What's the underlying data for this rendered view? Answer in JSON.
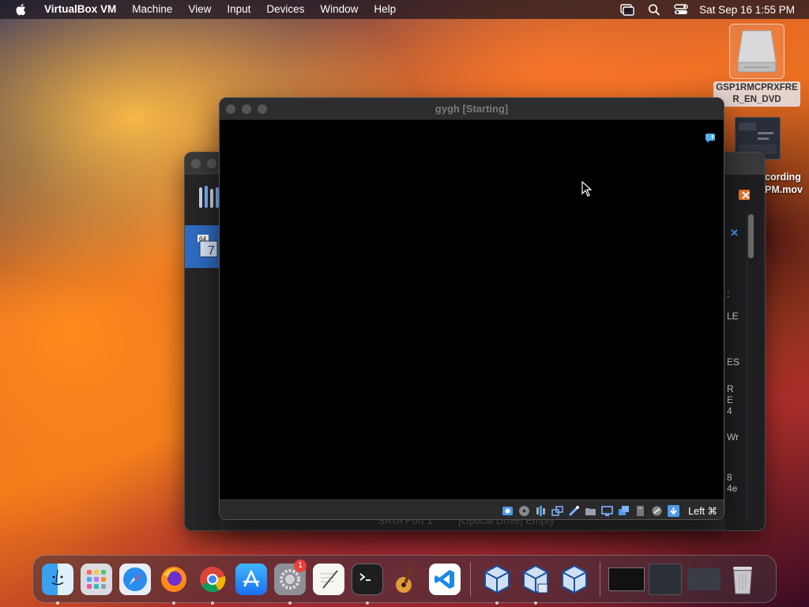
{
  "menubar": {
    "app_name": "VirtualBox VM",
    "menus": [
      "Machine",
      "View",
      "Input",
      "Devices",
      "Window",
      "Help"
    ],
    "clock": "Sat Sep 16  1:55 PM"
  },
  "desktop": {
    "dvd_label_line1": "GSP1RMCPRXFRE",
    "dvd_label_line2": "R_EN_DVD",
    "recording_label_line1": "cording",
    "recording_label_line2": "PM.mov"
  },
  "manager_window": {
    "details_fragments": [
      ":",
      "LE",
      "ES",
      "R",
      "E",
      "4",
      "Wr",
      "8",
      "4e"
    ],
    "storage_line_port": "SATA Port 1:",
    "storage_line_value": "[Optical Drive] Empty"
  },
  "vm_window": {
    "title": "gygh [Starting]",
    "host_key": "Left ⌘"
  },
  "dock": {
    "settings_badge": "1"
  },
  "colors": {
    "accent": "#2f6dc4",
    "badge": "#e8423a",
    "vm_screen": "#000000"
  }
}
